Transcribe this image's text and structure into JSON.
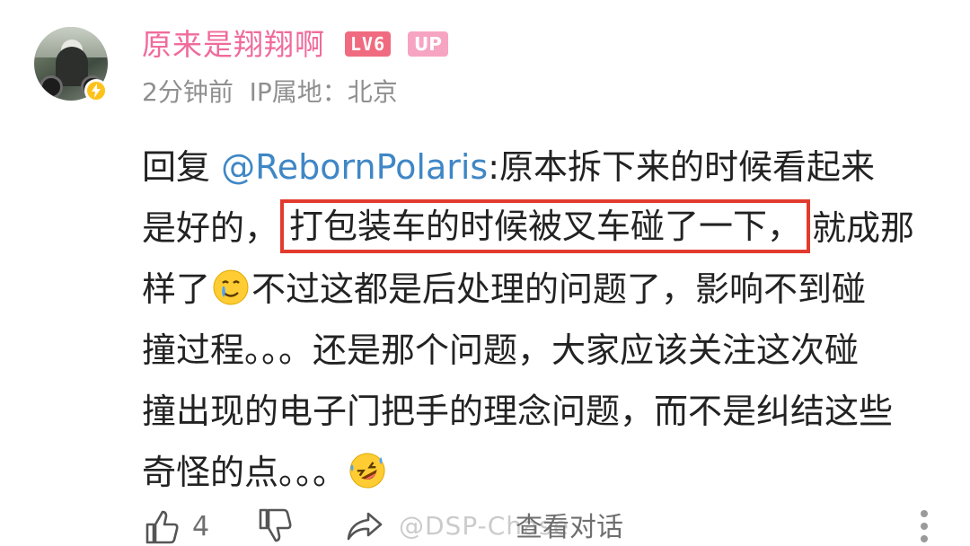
{
  "comment": {
    "username": "原来是翔翔啊",
    "level_badge": "LV6",
    "up_badge": "UP",
    "time": "2分钟前",
    "ip_location": "IP属地：北京",
    "reply_prefix": "回复 ",
    "mention": "@RebornPolaris",
    "text_lines": [
      ":原本拆下来的时候看起来",
      "是好的，",
      "打包装车的时候被叉车碰了一下，",
      "就成那",
      "样了",
      "不过这都是后处理的问题了，影响不到碰",
      "撞过程。。。还是那个问题，大家应该关注这次碰",
      "撞出现的电子门把手的理念问题，而不是纠结这些",
      "奇怪的点。。。"
    ],
    "emojis": [
      "crying-smile-emoji",
      "rofl-emoji"
    ]
  },
  "actions": {
    "like_count": "4",
    "view_conversation": "查看对话",
    "watermark": "@DSP-Chase"
  },
  "colors": {
    "username": "#f06b9b",
    "level_badge": "#f06b7f",
    "up_badge": "#f7a4c3",
    "mention": "#3f87c6",
    "highlight_border": "#e23b2e",
    "meta": "#8f8f8f"
  }
}
